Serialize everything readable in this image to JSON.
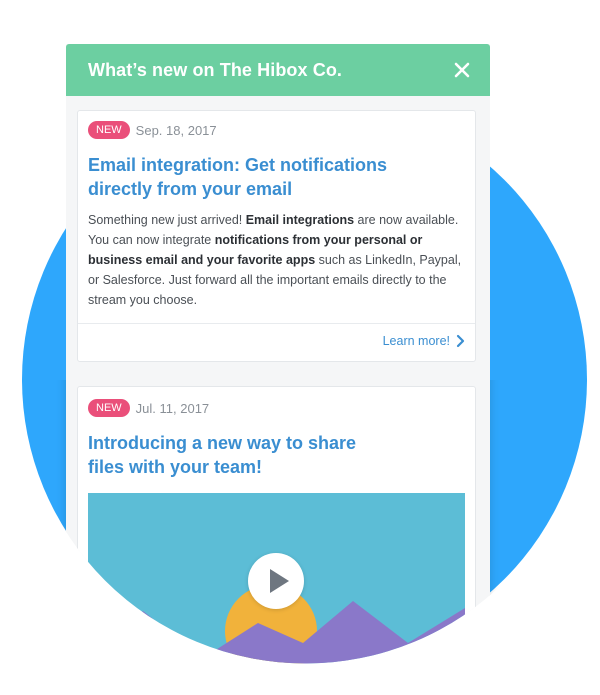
{
  "colors": {
    "circle": "#2ea7fc",
    "header": "#6ccfa1",
    "badge": "#ea4f7a",
    "title_blue": "#3a8ed1",
    "video_bg": "#5cbdd6",
    "mountain": "#8a78c9",
    "sun": "#f1b23b",
    "play_icon": "#6e7680"
  },
  "panel": {
    "title": "What’s new on The Hibox Co.",
    "close_icon": "close-icon"
  },
  "posts": [
    {
      "badge": "NEW",
      "date": "Sep. 18, 2017",
      "title_line1": "Email integration: Get notifications",
      "title_line2": "directly from your email",
      "body": {
        "t1": "Something new just arrived! ",
        "b1": "Email integrations",
        "t2": " are now available. You can now integrate ",
        "b2": "notifications from your personal or business email and your favorite apps",
        "t3": " such as LinkedIn, Paypal, or Salesforce. Just forward all the important emails directly to the stream you choose."
      },
      "link_label": "Learn more!",
      "link_icon": "chevron-right-icon"
    },
    {
      "badge": "NEW",
      "date": "Jul. 11, 2017",
      "title_line1": "Introducing a new way to share",
      "title_line2": "files with your team!",
      "media_icon": "play-icon"
    }
  ]
}
